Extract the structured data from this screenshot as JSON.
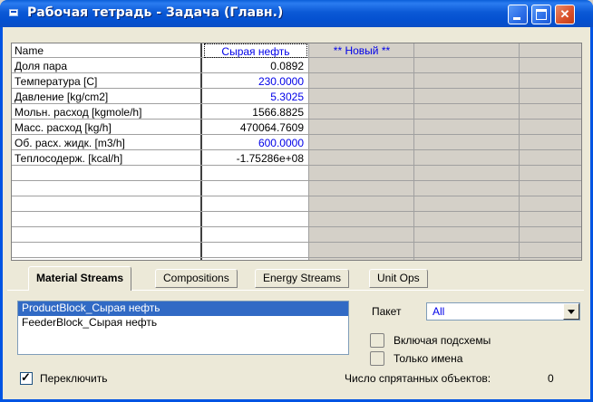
{
  "window": {
    "title": "Рабочая тетрадь - Задача (Главн.)"
  },
  "grid": {
    "header_name": "Name",
    "header_columns": [
      "Сырая нефть",
      "** Новый **",
      "",
      ""
    ],
    "rows": [
      {
        "label": "Доля пара",
        "value": "0.0892",
        "specified": false
      },
      {
        "label": "Температура [C]",
        "value": "230.0000",
        "specified": true
      },
      {
        "label": "Давление [kg/cm2]",
        "value": "5.3025",
        "specified": true
      },
      {
        "label": "Мольн. расход [kgmole/h]",
        "value": "1566.8825",
        "specified": false
      },
      {
        "label": "Масс. расход [kg/h]",
        "value": "470064.7609",
        "specified": false
      },
      {
        "label": "Об. расх. жидк. [m3/h]",
        "value": "600.0000",
        "specified": true
      },
      {
        "label": "Теплосодерж. [kcal/h]",
        "value": "-1.75286e+08",
        "specified": false
      }
    ]
  },
  "tabs": [
    "Material Streams",
    "Compositions",
    "Energy Streams",
    "Unit Ops"
  ],
  "active_tab": "Material Streams",
  "stream_list": [
    "ProductBlock_Сырая нефть",
    "FeederBlock_Сырая нефть"
  ],
  "selected_stream": "ProductBlock_Сырая нефть",
  "packet": {
    "label": "Пакет",
    "value": "All"
  },
  "options": {
    "include_subflowsheets": "Включая подсхемы",
    "names_only": "Только имена",
    "toggle": "Переключить",
    "toggle_checked": true
  },
  "hidden_objects": {
    "label": "Число спрятанных объектов:",
    "count": "0"
  },
  "colors": {
    "specified_value": "#0000e8",
    "selection": "#316ac5",
    "title_bar": "#0a4dc6"
  },
  "icons": [
    "window-menu-icon",
    "minimize-icon",
    "maximize-icon",
    "close-icon",
    "dropdown-arrow-icon",
    "checkmark-icon"
  ]
}
